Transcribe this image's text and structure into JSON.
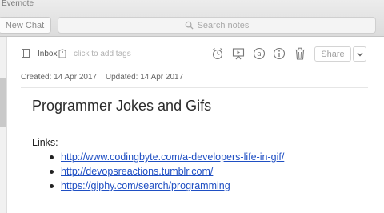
{
  "window": {
    "title": "Evernote"
  },
  "toolbar": {
    "new_chat_label": "New Chat",
    "search_placeholder": "Search notes"
  },
  "note_header": {
    "notebook_label": "Inbox",
    "tags_placeholder": "click to add tags",
    "share_label": "Share"
  },
  "meta": {
    "created": "Created: 14 Apr 2017",
    "updated": "Updated: 14 Apr 2017"
  },
  "note": {
    "title": "Programmer Jokes and Gifs",
    "links_label": "Links:",
    "links": [
      "http://www.codingbyte.com/a-developers-life-in-gif/",
      "http://devopsreactions.tumblr.com/",
      "https://giphy.com/search/programming"
    ]
  },
  "icons": [
    "search-icon",
    "notebook-icon",
    "tag-icon",
    "reminder-icon",
    "presentation-icon",
    "at-icon",
    "info-icon",
    "trash-icon",
    "chevron-down-icon"
  ],
  "colors": {
    "link": "#1f4fc3",
    "chrome": "#e2e2e2"
  }
}
